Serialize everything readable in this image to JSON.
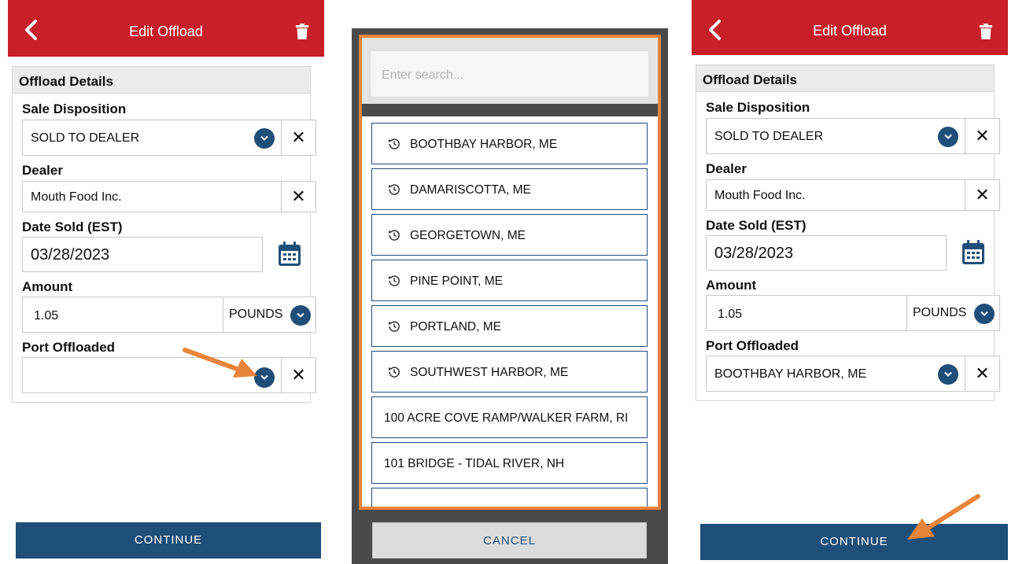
{
  "left_screen": {
    "header_title": "Edit Offload",
    "section_title": "Offload Details",
    "sale_disposition_label": "Sale Disposition",
    "sale_disposition_value": "SOLD TO DEALER",
    "dealer_label": "Dealer",
    "dealer_value": "Mouth Food Inc.",
    "date_label": "Date Sold (EST)",
    "date_value": "03/28/2023",
    "amount_label": "Amount",
    "amount_value": "1.05",
    "amount_units": "POUNDS",
    "port_label": "Port Offloaded",
    "port_value": "",
    "continue_label": "CONTINUE",
    "clear_symbol": "✕"
  },
  "picker": {
    "search_placeholder": "Enter search...",
    "recent_items": [
      "BOOTHBAY HARBOR, ME",
      "DAMARISCOTTA, ME",
      "GEORGETOWN, ME",
      "PINE POINT, ME",
      "PORTLAND, ME",
      "SOUTHWEST HARBOR, ME"
    ],
    "items": [
      "100 ACRE COVE RAMP/WALKER FARM, RI",
      "101 BRIDGE - TIDAL RIVER, NH"
    ],
    "cancel_label": "CANCEL"
  },
  "right_screen": {
    "header_title": "Edit Offload",
    "section_title": "Offload Details",
    "sale_disposition_label": "Sale Disposition",
    "sale_disposition_value": "SOLD TO DEALER",
    "dealer_label": "Dealer",
    "dealer_value": "Mouth Food Inc.",
    "date_label": "Date Sold (EST)",
    "date_value": "03/28/2023",
    "amount_label": "Amount",
    "amount_value": "1.05",
    "amount_units": "POUNDS",
    "port_label": "Port Offloaded",
    "port_value": "BOOTHBAY HARBOR, ME",
    "continue_label": "CONTINUE",
    "clear_symbol": "✕"
  },
  "colors": {
    "header_red": "#c8202a",
    "primary_blue": "#1f4e79",
    "highlight_orange": "#e8853a",
    "overlay_gray": "#4a4a4a"
  },
  "icons": {
    "back": "chevron-left-icon",
    "delete": "trash-icon",
    "dropdown": "chevron-down-icon",
    "clear": "close-icon",
    "calendar": "calendar-icon",
    "recent": "history-icon",
    "annotation": "arrow-icon"
  }
}
